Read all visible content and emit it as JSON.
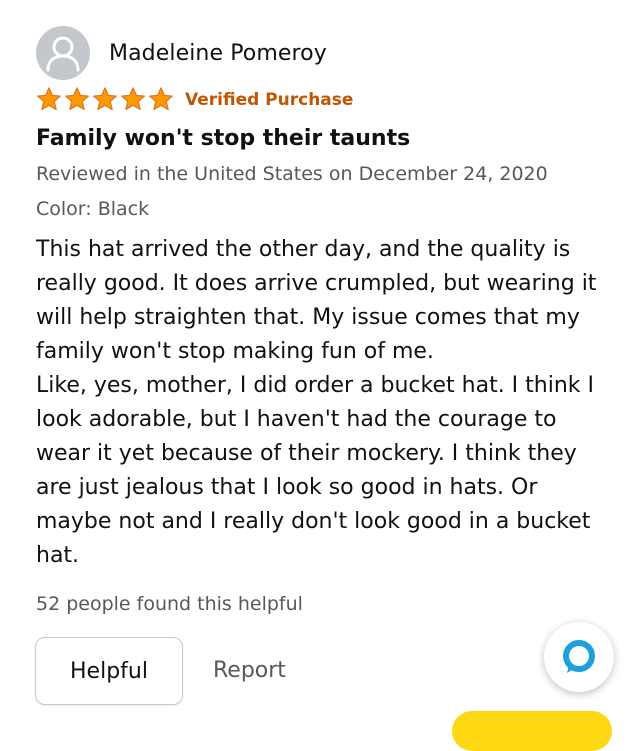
{
  "reviewer": {
    "name": "Madeleine Pomeroy"
  },
  "rating": {
    "stars": 5,
    "max": 5,
    "badge": "Verified Purchase",
    "star_color": "#ff9900",
    "badge_color": "#c45500"
  },
  "review": {
    "title": "Family won't stop their taunts",
    "meta": "Reviewed in the United States on December 24, 2020",
    "color_option": "Color: Black",
    "body": [
      "This hat arrived the other day, and the quality is really good. It does arrive crumpled, but wearing it will help straighten that. My issue comes that my family won't stop making fun of me.",
      "Like, yes, mother, I did order a bucket hat. I think I look adorable, but I haven't had the courage to wear it yet because of their mockery. I think they are just jealous that I look so good in hats. Or maybe not and I really don't look good in a bucket hat."
    ]
  },
  "helpful_count": "52 people found this helpful",
  "actions": {
    "helpful_label": "Helpful",
    "report_label": "Report"
  },
  "icons": {
    "avatar": "person-icon",
    "alexa": "alexa-icon",
    "star": "star-icon"
  },
  "colors": {
    "alexa_ring": "#1fa0dc",
    "meta_text": "#565959"
  }
}
